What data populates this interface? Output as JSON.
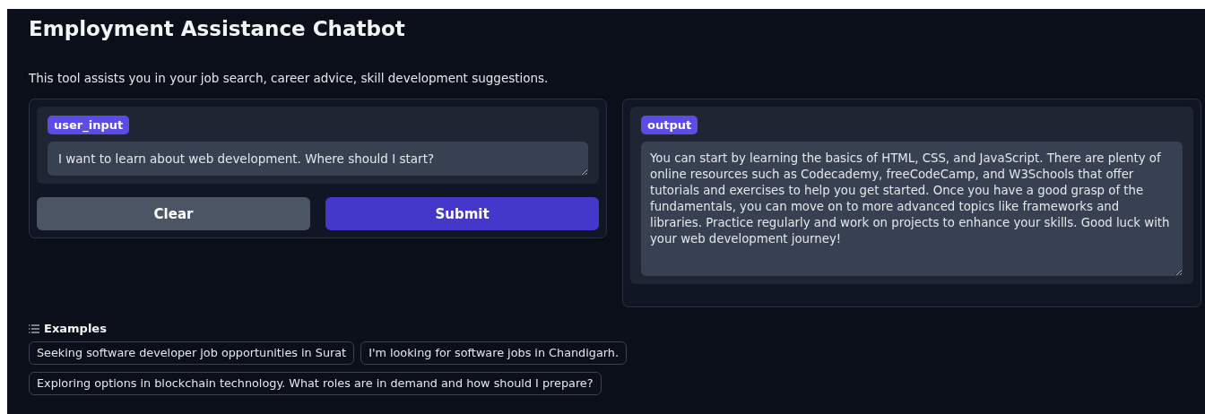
{
  "title": "Employment Assistance Chatbot",
  "description": "This tool assists you in your job search, career advice, skill development suggestions.",
  "input": {
    "label": "user_input",
    "value": "I want to learn about web development. Where should I start?"
  },
  "buttons": [
    {
      "label": "Clear",
      "kind": "secondary"
    },
    {
      "label": "Submit",
      "kind": "primary"
    }
  ],
  "output": {
    "label": "output",
    "value": "You can start by learning the basics of HTML, CSS, and JavaScript. There are plenty of online resources such as Codecademy, freeCodeCamp, and W3Schools that offer tutorials and exercises to help you get started. Once you have a good grasp of the fundamentals, you can move on to more advanced topics like frameworks and libraries. Practice regularly and work on projects to enhance your skills. Good luck with your web development journey!"
  },
  "examples": {
    "heading": "Examples",
    "items": [
      {
        "text": "Seeking software developer job opportunities in Surat"
      },
      {
        "text": "I'm looking for software jobs in Chandigarh."
      },
      {
        "text": "Exploring options in blockchain technology. What roles are in demand and how should I prepare?"
      }
    ]
  }
}
